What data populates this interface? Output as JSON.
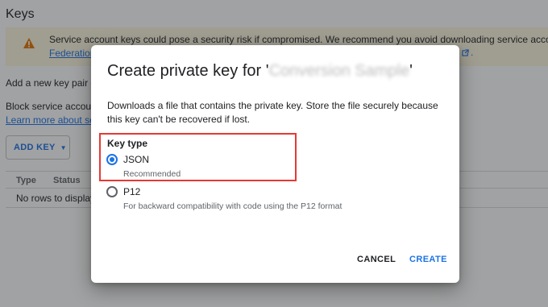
{
  "page": {
    "title": "Keys",
    "warning": {
      "line1": "Service account keys could pose a security risk if compromised. We recommend you avoid downloading service account keys and in",
      "link_left": "Federation",
      "link_right_suffix": "."
    },
    "add_new_text": "Add a new key pair or u",
    "block_text": "Block service account k",
    "learn_link": "Learn more about setti",
    "add_key_label": "ADD KEY",
    "add_key_caret": "▼",
    "table": {
      "columns": [
        "Type",
        "Status"
      ],
      "empty_text": "No rows to display"
    }
  },
  "dialog": {
    "title_prefix": "Create private key for '",
    "title_name": "Conversion Sample",
    "title_suffix": "'",
    "description": "Downloads a file that contains the private key. Store the file securely because this key can't be recovered if lost.",
    "key_type_label": "Key type",
    "options": [
      {
        "label": "JSON",
        "sub": "Recommended",
        "selected": true
      },
      {
        "label": "P12",
        "sub": "For backward compatibility with code using the P12 format",
        "selected": false
      }
    ],
    "cancel_label": "CANCEL",
    "create_label": "CREATE"
  },
  "colors": {
    "accent": "#1a73e8",
    "highlight": "#e53935",
    "warning_icon": "#e37400"
  }
}
